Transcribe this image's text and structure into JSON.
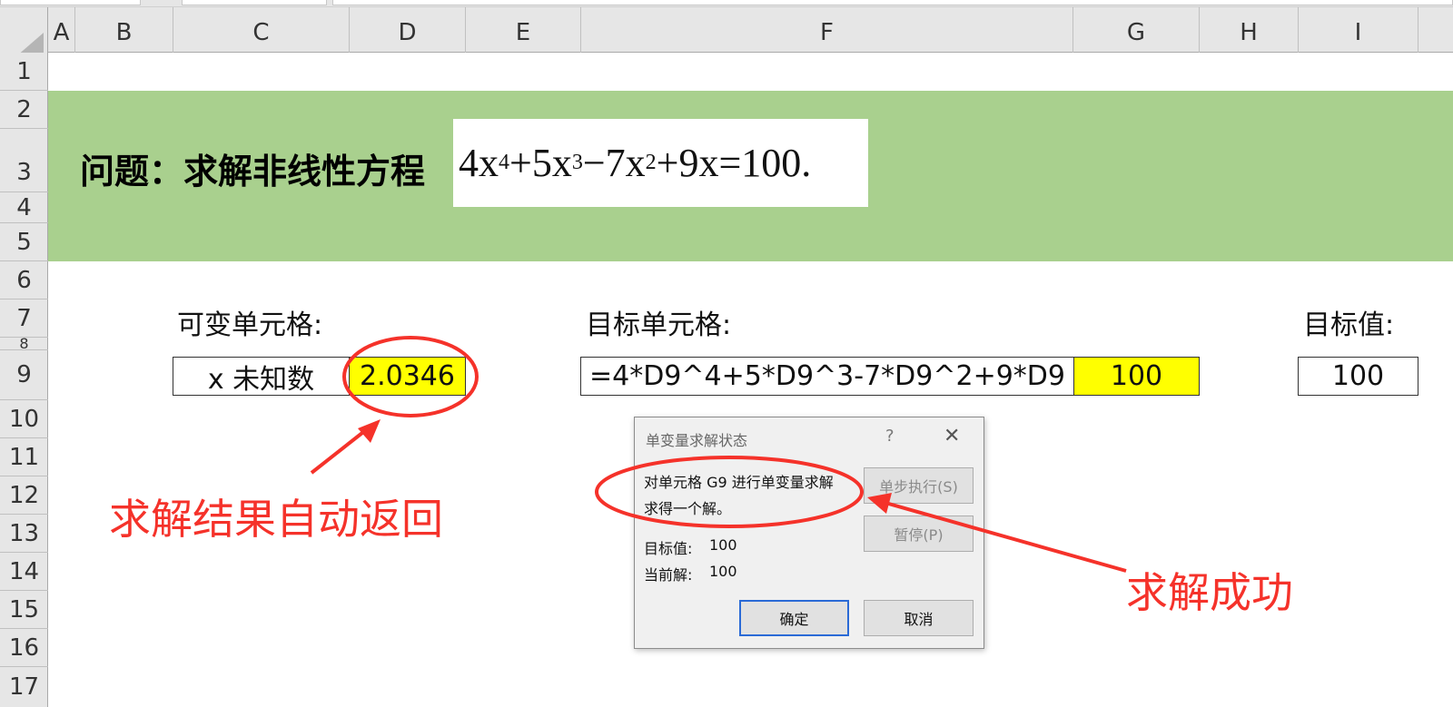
{
  "columns": [
    "A",
    "B",
    "C",
    "D",
    "E",
    "F",
    "G",
    "H",
    "I"
  ],
  "rows": [
    "1",
    "2",
    "3",
    "4",
    "5",
    "6",
    "7",
    "8",
    "9",
    "10",
    "11",
    "12",
    "13",
    "14",
    "15",
    "16",
    "17"
  ],
  "banner": {
    "title": "问题：求解非线性方程",
    "equation": {
      "t1": "4x",
      "p1": "4",
      "t2": "+5x",
      "p2": "3",
      "t3": "−7x",
      "p3": "2",
      "t4": "+9x=100",
      "tail": "."
    },
    "color": "#a9d08e"
  },
  "labels": {
    "variable_cell": "可变单元格:",
    "target_cell": "目标单元格:",
    "target_value": "目标值:"
  },
  "cells": {
    "x_label": "x 未知数",
    "x_value": "2.0346",
    "formula": "=4*D9^4+5*D9^3-7*D9^2+9*D9",
    "formula_result": "100",
    "target": "100"
  },
  "dialog": {
    "title": "单变量求解状态",
    "help": "?",
    "close": "✕",
    "message_line1": "对单元格 G9 进行单变量求解",
    "message_line2": "求得一个解。",
    "target_label": "目标值:",
    "target_val": "100",
    "current_label": "当前解:",
    "current_val": "100",
    "step_button": "单步执行(S)",
    "pause_button": "暂停(P)",
    "ok_button": "确定",
    "cancel_button": "取消"
  },
  "annotations": {
    "auto_return": "求解结果自动返回",
    "success": "求解成功",
    "color": "#f5322a"
  },
  "highlight_color": "#ffff00"
}
